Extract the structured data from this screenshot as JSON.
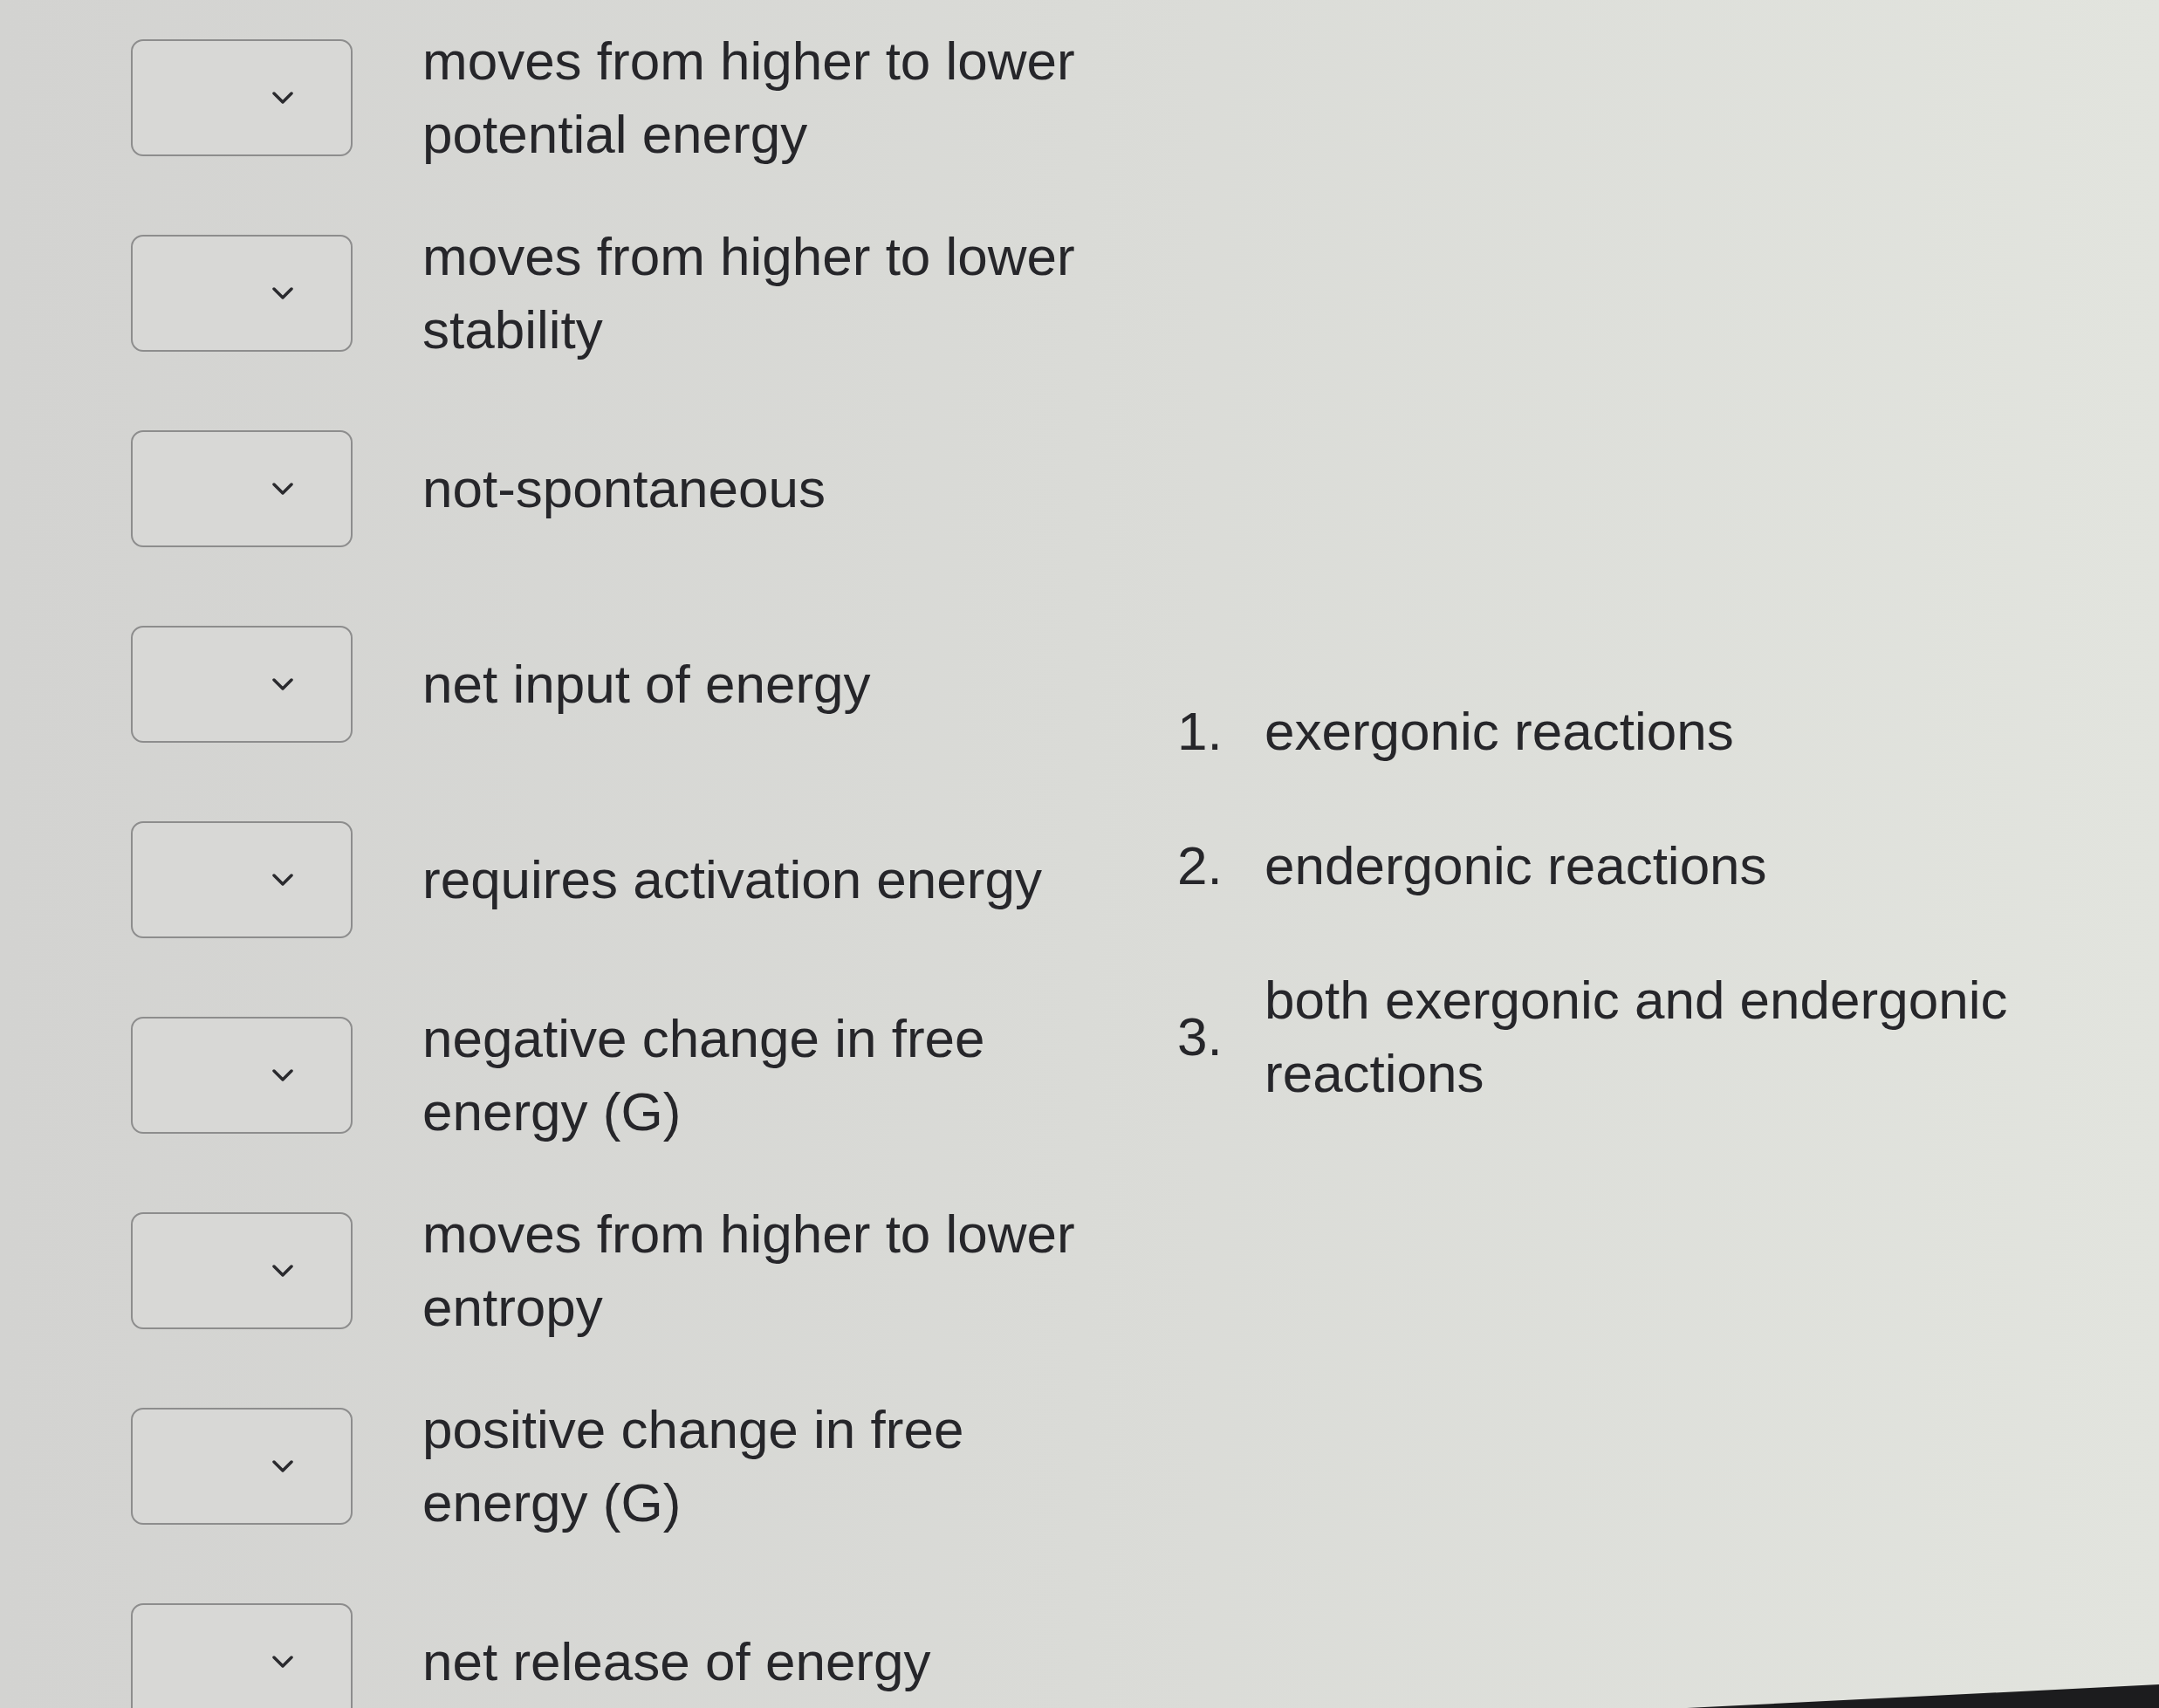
{
  "statements": [
    {
      "text": "moves from higher to lower potential energy"
    },
    {
      "text": "moves from higher to lower stability"
    },
    {
      "text": "not-spontaneous"
    },
    {
      "text": "net input of energy"
    },
    {
      "text": "requires activation energy"
    },
    {
      "text": "negative change in free energy (G)"
    },
    {
      "text": "moves from higher to lower entropy"
    },
    {
      "text": "positive change in free energy (G)"
    },
    {
      "text": "net release of energy"
    }
  ],
  "choices": [
    {
      "number": "1.",
      "text": "exergonic reactions"
    },
    {
      "number": "2.",
      "text": "endergonic reactions"
    },
    {
      "number": "3.",
      "text": "both exergonic and endergonic reactions"
    }
  ]
}
